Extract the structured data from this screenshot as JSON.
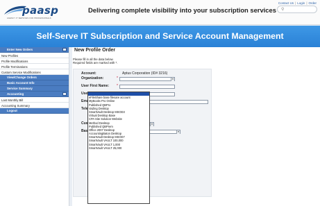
{
  "header": {
    "top_links": [
      "Contact Us",
      "Login",
      "Order"
    ],
    "logo_text": "paasp",
    "logo_tagline": "AGENCY IT SERVICES FOR PROFESSIONALS",
    "tagline": "Delivering complete visibility into your subscription services",
    "search_placeholder": "",
    "brand_color": "#2a81d6"
  },
  "band": {
    "title": "Self-Serve IT Subscription and Service Account Management"
  },
  "sidebar": {
    "groups": [
      {
        "label": "Enter New Orders",
        "items": [
          "New Profiles",
          "Profile Modifications",
          "Profile Terminations",
          "Custom Service Modifications"
        ]
      },
      {
        "label": "View/Change Orders",
        "items": []
      },
      {
        "label": "Basic Account Info",
        "items": []
      },
      {
        "label": "Service Summary",
        "items": []
      },
      {
        "label": "Accounting",
        "items": [
          "Last Monthly Bill",
          "Accounting Summary"
        ]
      },
      {
        "label": "Logout",
        "items": []
      }
    ]
  },
  "main": {
    "title": "New Profile Order",
    "intro_line1": "Please fill in all the data below.",
    "intro_line2": "Required fields are marked with *.",
    "form": {
      "account_label": "Account:",
      "account_value": "Aptus Corporation (ID# 3216)",
      "organization_label": "Organization:",
      "first_name_label": "User First Name:",
      "last_name_label": "User Last Name:",
      "email_label": "Email Address:",
      "telephone_label": "Telephone:",
      "custom_service_label": "Custom Service:",
      "base_service_label": "Base Service:",
      "required_mark": "*"
    },
    "base_service_options": [
      "",
      "eFileShare base filesare account",
      "MyBooks Pro Online",
      "Published QBPro",
      "VaZing Desktop",
      "SmartVault Desktop MSOD3",
      "Virtual Desktop Base",
      "CPA Site Solution Website",
      "Method Desktop",
      "Published QBPrem",
      "Office 2007 Desktop",
      "AccountingBaton Desktop",
      "SmartVault Desktop MSOD7",
      "SmartVault VAULT 100,000",
      "SmartVault VAULT 1,000",
      "SmartVault VAULT 25,000"
    ],
    "highlighted_option_index": 0
  }
}
